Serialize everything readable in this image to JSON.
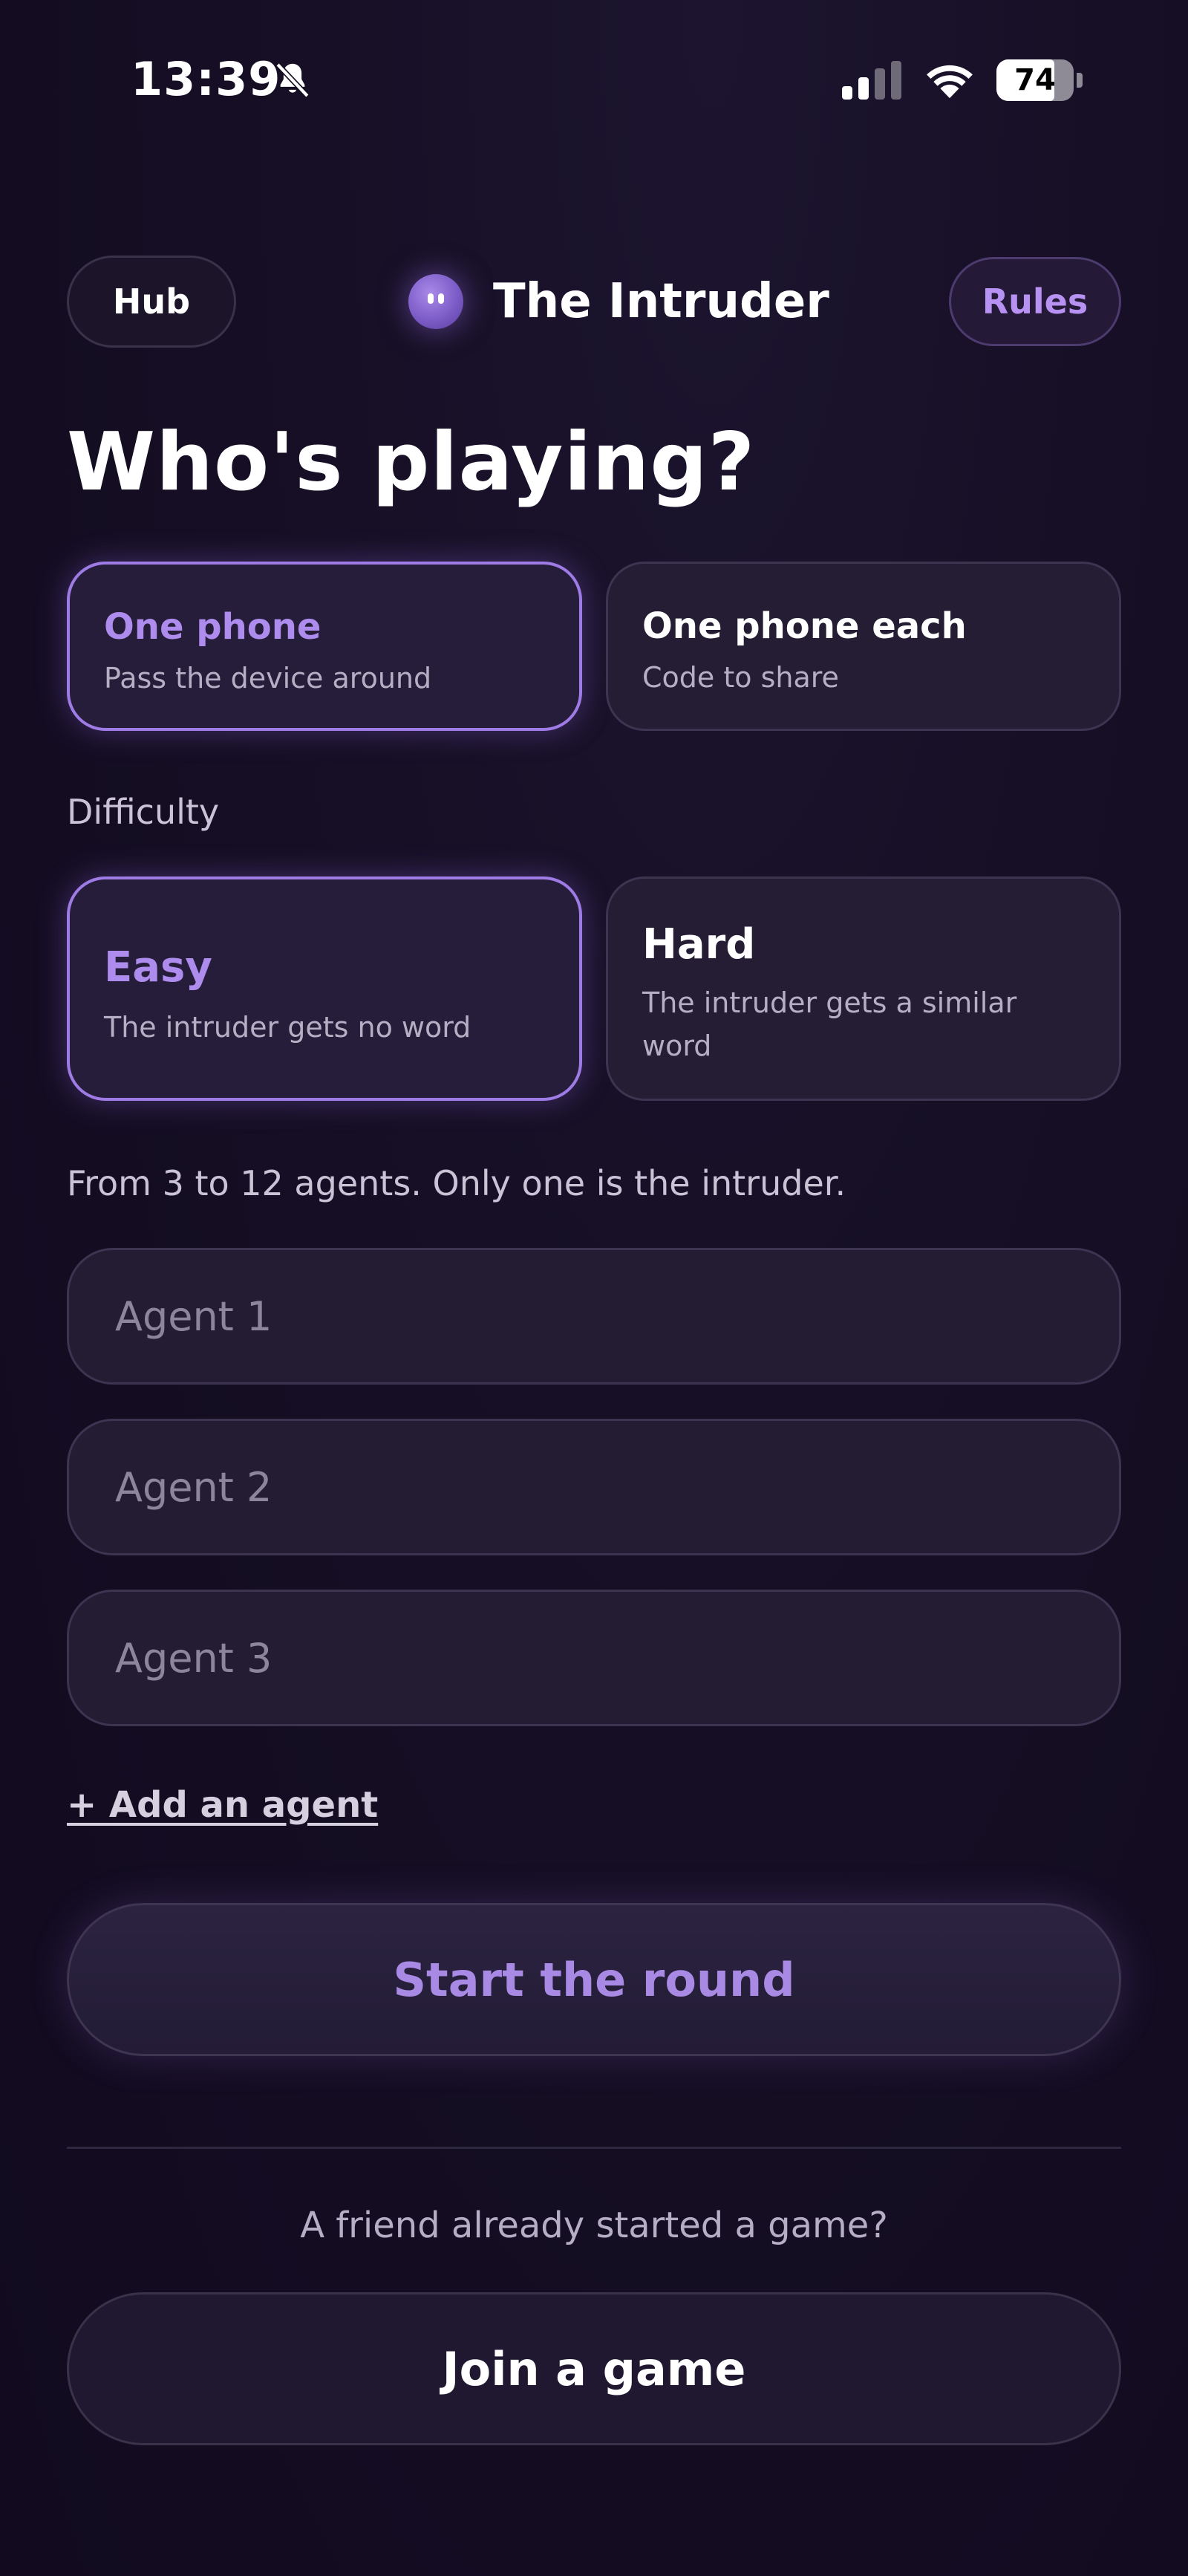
{
  "status_bar": {
    "time": "13:39",
    "battery": "74"
  },
  "header": {
    "hub_label": "Hub",
    "app_title": "The Intruder",
    "rules_label": "Rules"
  },
  "page_title": "Who's playing?",
  "mode": {
    "options": [
      {
        "title": "One phone",
        "subtitle": "Pass the device around",
        "selected": true
      },
      {
        "title": "One phone each",
        "subtitle": "Code to share",
        "selected": false
      }
    ]
  },
  "difficulty": {
    "label": "Difficulty",
    "options": [
      {
        "title": "Easy",
        "subtitle": "The intruder gets no word",
        "selected": true
      },
      {
        "title": "Hard",
        "subtitle": "The intruder gets a similar word",
        "selected": false
      }
    ]
  },
  "agents": {
    "hint": "From 3 to 12 agents. Only one is the intruder.",
    "inputs": [
      {
        "placeholder": "Agent 1",
        "value": ""
      },
      {
        "placeholder": "Agent 2",
        "value": ""
      },
      {
        "placeholder": "Agent 3",
        "value": ""
      }
    ],
    "add_label": "+ Add an agent"
  },
  "start_label": "Start the round",
  "join": {
    "prompt": "A friend already started a game?",
    "button_label": "Join a game"
  },
  "colors": {
    "accent": "#9f7be6",
    "background": "#140d22"
  }
}
